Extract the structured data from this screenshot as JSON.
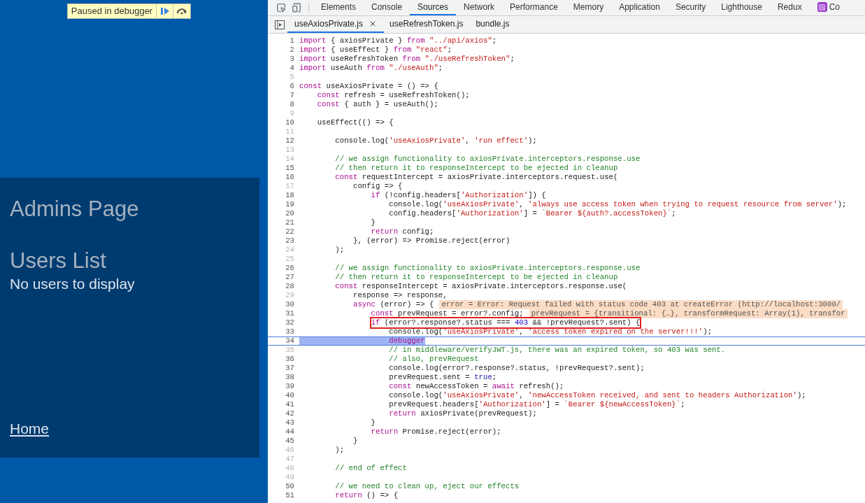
{
  "page": {
    "debug_badge": {
      "label": "Paused in debugger"
    },
    "heading": "Admins Page",
    "subheading": "Users List",
    "message": "No users to display",
    "link": "Home"
  },
  "devtools": {
    "tabs": [
      {
        "label": "Elements",
        "selected": false
      },
      {
        "label": "Console",
        "selected": false
      },
      {
        "label": "Sources",
        "selected": true
      },
      {
        "label": "Network",
        "selected": false
      },
      {
        "label": "Performance",
        "selected": false
      },
      {
        "label": "Memory",
        "selected": false
      },
      {
        "label": "Application",
        "selected": false
      },
      {
        "label": "Security",
        "selected": false
      },
      {
        "label": "Lighthouse",
        "selected": false
      },
      {
        "label": "Redux",
        "selected": false
      },
      {
        "label": "Co",
        "selected": false,
        "kind": "react"
      }
    ],
    "files": [
      {
        "label": "useAxiosPrivate.js",
        "selected": true,
        "closable": true
      },
      {
        "label": "useRefreshToken.js",
        "selected": false,
        "closable": false
      },
      {
        "label": "bundle.js",
        "selected": false,
        "closable": false
      }
    ],
    "lines": [
      {
        "number": "1",
        "dimmed": false,
        "tokens": [
          {
            "kind": "kw",
            "text": "import"
          },
          {
            "kind": "plain",
            "text": " { axiosPrivate } "
          },
          {
            "kind": "kw",
            "text": "from"
          },
          {
            "kind": "str",
            "text": " \"../api/axios\""
          },
          {
            "kind": "plain",
            "text": ";"
          }
        ]
      },
      {
        "number": "2",
        "dimmed": false,
        "tokens": [
          {
            "kind": "kw",
            "text": "import"
          },
          {
            "kind": "plain",
            "text": " { useEffect } "
          },
          {
            "kind": "kw",
            "text": "from"
          },
          {
            "kind": "str",
            "text": " \"react\""
          },
          {
            "kind": "plain",
            "text": ";"
          }
        ]
      },
      {
        "number": "3",
        "dimmed": false,
        "tokens": [
          {
            "kind": "kw",
            "text": "import"
          },
          {
            "kind": "plain",
            "text": " useRefreshToken "
          },
          {
            "kind": "kw",
            "text": "from"
          },
          {
            "kind": "str",
            "text": " \"./useRefreshToken\""
          },
          {
            "kind": "plain",
            "text": ";"
          }
        ]
      },
      {
        "number": "4",
        "dimmed": false,
        "tokens": [
          {
            "kind": "kw",
            "text": "import"
          },
          {
            "kind": "plain",
            "text": " useAuth "
          },
          {
            "kind": "kw",
            "text": "from"
          },
          {
            "kind": "str",
            "text": " \"./useAuth\""
          },
          {
            "kind": "plain",
            "text": ";"
          }
        ]
      },
      {
        "number": "5",
        "dimmed": true
      },
      {
        "number": "6",
        "dimmed": false,
        "tokens": [
          {
            "kind": "kw",
            "text": "const"
          },
          {
            "kind": "plain",
            "text": " useAxiosPrivate = () => {"
          }
        ]
      },
      {
        "number": "7",
        "dimmed": false,
        "tokens": [
          {
            "kind": "kw",
            "text": "    const"
          },
          {
            "kind": "plain",
            "text": " refresh = useRefreshToken();"
          }
        ]
      },
      {
        "number": "8",
        "dimmed": false,
        "tokens": [
          {
            "kind": "kw",
            "text": "    const"
          },
          {
            "kind": "plain",
            "text": " { auth } = useAuth();"
          }
        ]
      },
      {
        "number": "9",
        "dimmed": true
      },
      {
        "number": "10",
        "dimmed": false,
        "tokens": [
          {
            "kind": "plain",
            "text": "    useEffect(() => {"
          }
        ]
      },
      {
        "number": "11",
        "dimmed": true
      },
      {
        "number": "12",
        "dimmed": false,
        "tokens": [
          {
            "kind": "plain",
            "text": "        console.log("
          },
          {
            "kind": "str",
            "text": "'useAxiosPrivate'"
          },
          {
            "kind": "plain",
            "text": ", "
          },
          {
            "kind": "str",
            "text": "'run effect'"
          },
          {
            "kind": "plain",
            "text": ");"
          }
        ]
      },
      {
        "number": "13",
        "dimmed": true
      },
      {
        "number": "14",
        "dimmed": true,
        "tokens": [
          {
            "kind": "cm",
            "text": "        // we assign functionality to axiosPrivate.interceptors.response.use"
          }
        ]
      },
      {
        "number": "15",
        "dimmed": false,
        "tokens": [
          {
            "kind": "cm",
            "text": "        // then return it to responseIntercept to be ejected in cleanup"
          }
        ]
      },
      {
        "number": "16",
        "dimmed": false,
        "tokens": [
          {
            "kind": "kw",
            "text": "        const"
          },
          {
            "kind": "plain",
            "text": " requestIntercept = axiosPrivate.interceptors.request.use("
          }
        ]
      },
      {
        "number": "17",
        "dimmed": true,
        "tokens": [
          {
            "kind": "plain",
            "text": "            config => {"
          }
        ]
      },
      {
        "number": "18",
        "dimmed": false,
        "tokens": [
          {
            "kind": "kw",
            "text": "                if"
          },
          {
            "kind": "plain",
            "text": " (!config.headers["
          },
          {
            "kind": "str",
            "text": "'Authorization'"
          },
          {
            "kind": "plain",
            "text": "]) {"
          }
        ]
      },
      {
        "number": "19",
        "dimmed": false,
        "tokens": [
          {
            "kind": "plain",
            "text": "                    console.log("
          },
          {
            "kind": "str",
            "text": "'useAxiosPrivate'"
          },
          {
            "kind": "plain",
            "text": ", "
          },
          {
            "kind": "str",
            "text": "'always use access token when trying to request resource from server'"
          },
          {
            "kind": "plain",
            "text": ");"
          }
        ]
      },
      {
        "number": "20",
        "dimmed": false,
        "tokens": [
          {
            "kind": "plain",
            "text": "                    config.headers["
          },
          {
            "kind": "str",
            "text": "'Authorization'"
          },
          {
            "kind": "plain",
            "text": "] = "
          },
          {
            "kind": "str",
            "text": "`Bearer ${auth?.accessToken}`"
          },
          {
            "kind": "plain",
            "text": ";"
          }
        ]
      },
      {
        "number": "21",
        "dimmed": false,
        "tokens": [
          {
            "kind": "plain",
            "text": "                }"
          }
        ]
      },
      {
        "number": "22",
        "dimmed": false,
        "tokens": [
          {
            "kind": "kw",
            "text": "                return"
          },
          {
            "kind": "plain",
            "text": " config;"
          }
        ]
      },
      {
        "number": "23",
        "dimmed": false,
        "tokens": [
          {
            "kind": "plain",
            "text": "            }, (error) => Promise.reject(error)"
          }
        ]
      },
      {
        "number": "24",
        "dimmed": true,
        "tokens": [
          {
            "kind": "plain",
            "text": "        );"
          }
        ]
      },
      {
        "number": "25",
        "dimmed": true
      },
      {
        "number": "26",
        "dimmed": false,
        "tokens": [
          {
            "kind": "cm",
            "text": "        // we assign functionality to axiosPrivate.interceptors.response.use"
          }
        ]
      },
      {
        "number": "27",
        "dimmed": false,
        "tokens": [
          {
            "kind": "cm",
            "text": "        // then return it to responseIntercept to be ejected in cleanup"
          }
        ]
      },
      {
        "number": "28",
        "dimmed": false,
        "tokens": [
          {
            "kind": "kw",
            "text": "        const"
          },
          {
            "kind": "plain",
            "text": " responseIntercept = axiosPrivate.interceptors.response.use("
          }
        ]
      },
      {
        "number": "29",
        "dimmed": true,
        "tokens": [
          {
            "kind": "plain",
            "text": "            response => response,"
          }
        ]
      },
      {
        "number": "30",
        "dimmed": false,
        "tokens": [
          {
            "kind": "kw",
            "text": "            async"
          },
          {
            "kind": "plain",
            "text": " (error) => {"
          }
        ],
        "preview": "error = Error: Request failed with status code 403 at createError (http://localhost:3000/"
      },
      {
        "number": "31",
        "dimmed": false,
        "tokens": [
          {
            "kind": "kw",
            "text": "                const"
          },
          {
            "kind": "plain",
            "text": " prevRequest = error?.config;"
          }
        ],
        "preview": "prevRequest = {transitional: {…}, transformRequest: Array(1), transfor"
      },
      {
        "number": "32",
        "dimmed": false,
        "boxed": true,
        "tokens": [
          {
            "kind": "kw",
            "text": "                if"
          },
          {
            "kind": "plain",
            "text": " (error?.response?.status === "
          },
          {
            "kind": "num",
            "text": "403"
          },
          {
            "kind": "plain",
            "text": " && !prevRequest?.sent) {"
          }
        ]
      },
      {
        "number": "33",
        "dimmed": false,
        "tokens": [
          {
            "kind": "plain",
            "text": "                    console.log("
          },
          {
            "kind": "str",
            "text": "'useAxiosPrivate'"
          },
          {
            "kind": "plain",
            "text": ", "
          },
          {
            "kind": "str",
            "text": "'access token expired on the server!!!'"
          },
          {
            "kind": "plain",
            "text": ");"
          }
        ]
      },
      {
        "number": "34",
        "dimmed": false,
        "current": true,
        "tokens": [
          {
            "kind": "kw",
            "text": "                    debugger"
          }
        ]
      },
      {
        "number": "35",
        "dimmed": true,
        "tokens": [
          {
            "kind": "cm",
            "text": "                    // in middleware/verifyJWT.js, there was an expired token, so 403 was sent."
          }
        ]
      },
      {
        "number": "36",
        "dimmed": false,
        "tokens": [
          {
            "kind": "cm",
            "text": "                    // also, prevRequest"
          }
        ]
      },
      {
        "number": "37",
        "dimmed": false,
        "tokens": [
          {
            "kind": "plain",
            "text": "                    console.log(error?.response?.status, !prevRequest?.sent);"
          }
        ]
      },
      {
        "number": "38",
        "dimmed": false,
        "tokens": [
          {
            "kind": "plain",
            "text": "                    prevRequest.sent = "
          },
          {
            "kind": "lit",
            "text": "true"
          },
          {
            "kind": "plain",
            "text": ";"
          }
        ]
      },
      {
        "number": "39",
        "dimmed": false,
        "tokens": [
          {
            "kind": "kw",
            "text": "                    const"
          },
          {
            "kind": "plain",
            "text": " newAccessToken = "
          },
          {
            "kind": "kw",
            "text": "await"
          },
          {
            "kind": "plain",
            "text": " refresh();"
          }
        ]
      },
      {
        "number": "40",
        "dimmed": false,
        "tokens": [
          {
            "kind": "plain",
            "text": "                    console.log("
          },
          {
            "kind": "str",
            "text": "'useAxiosPrivate'"
          },
          {
            "kind": "plain",
            "text": ", "
          },
          {
            "kind": "str",
            "text": "'newAccessToken received, and sent to headers Authorization'"
          },
          {
            "kind": "plain",
            "text": ");"
          }
        ]
      },
      {
        "number": "41",
        "dimmed": false,
        "tokens": [
          {
            "kind": "plain",
            "text": "                    prevRequest.headers["
          },
          {
            "kind": "str",
            "text": "'Authorization'"
          },
          {
            "kind": "plain",
            "text": "] = "
          },
          {
            "kind": "str",
            "text": "`Bearer ${newAccessToken}`"
          },
          {
            "kind": "plain",
            "text": ";"
          }
        ]
      },
      {
        "number": "42",
        "dimmed": false,
        "tokens": [
          {
            "kind": "kw",
            "text": "                    return"
          },
          {
            "kind": "plain",
            "text": " axiosPrivate(prevRequest);"
          }
        ]
      },
      {
        "number": "43",
        "dimmed": false,
        "tokens": [
          {
            "kind": "plain",
            "text": "                }"
          }
        ]
      },
      {
        "number": "44",
        "dimmed": false,
        "tokens": [
          {
            "kind": "kw",
            "text": "                return"
          },
          {
            "kind": "plain",
            "text": " Promise.reject(error);"
          }
        ]
      },
      {
        "number": "45",
        "dimmed": false,
        "tokens": [
          {
            "kind": "plain",
            "text": "            }"
          }
        ]
      },
      {
        "number": "46",
        "dimmed": true,
        "tokens": [
          {
            "kind": "plain",
            "text": "        );"
          }
        ]
      },
      {
        "number": "47",
        "dimmed": true
      },
      {
        "number": "48",
        "dimmed": true,
        "tokens": [
          {
            "kind": "cm",
            "text": "        // end of effect"
          }
        ]
      },
      {
        "number": "49",
        "dimmed": true
      },
      {
        "number": "50",
        "dimmed": false,
        "tokens": [
          {
            "kind": "cm",
            "text": "        // we need to clean up, eject our effects"
          }
        ]
      },
      {
        "number": "51",
        "dimmed": false,
        "tokens": [
          {
            "kind": "kw",
            "text": "        return"
          },
          {
            "kind": "plain",
            "text": " () => {"
          }
        ]
      }
    ]
  }
}
